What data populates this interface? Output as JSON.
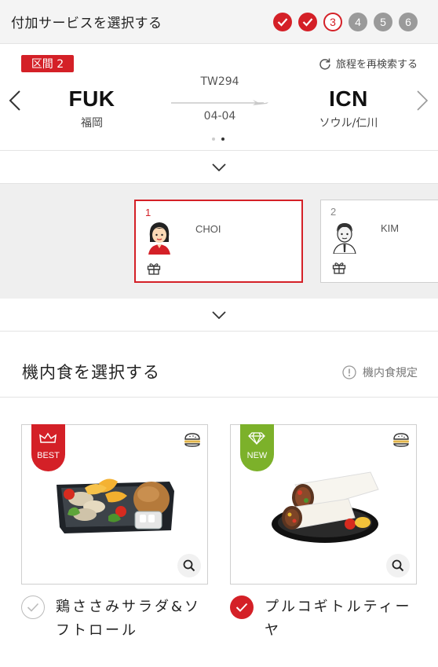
{
  "header": {
    "title": "付加サービスを選択する",
    "steps": [
      {
        "label": "",
        "state": "done"
      },
      {
        "label": "",
        "state": "done"
      },
      {
        "label": "3",
        "state": "current"
      },
      {
        "label": "4",
        "state": "todo"
      },
      {
        "label": "5",
        "state": "todo"
      },
      {
        "label": "6",
        "state": "todo"
      }
    ]
  },
  "segment": {
    "badge": "区間 2",
    "research_label": "旅程を再検索する",
    "flight_number": "TW294",
    "date": "04-04",
    "departure": {
      "code": "FUK",
      "name": "福岡"
    },
    "arrival": {
      "code": "ICN",
      "name": "ソウル/仁川"
    },
    "page_count": 2,
    "active_page": 2
  },
  "passengers": [
    {
      "number": "1",
      "name": "CHOI",
      "selected": true
    },
    {
      "number": "2",
      "name": "KIM",
      "selected": false
    }
  ],
  "meal_section": {
    "title": "機内食を選択する",
    "rules_label": "機内食規定"
  },
  "meals": [
    {
      "badge": "BEST",
      "name": "鶏ささみサラダ&ソフトロール",
      "selected": false
    },
    {
      "badge": "NEW",
      "name": "プルコギトルティーヤ",
      "selected": true
    }
  ],
  "colors": {
    "accent": "#d42027",
    "new_badge": "#7cb12a",
    "step_todo": "#9a9a9a",
    "panel_bg": "#efefef"
  }
}
